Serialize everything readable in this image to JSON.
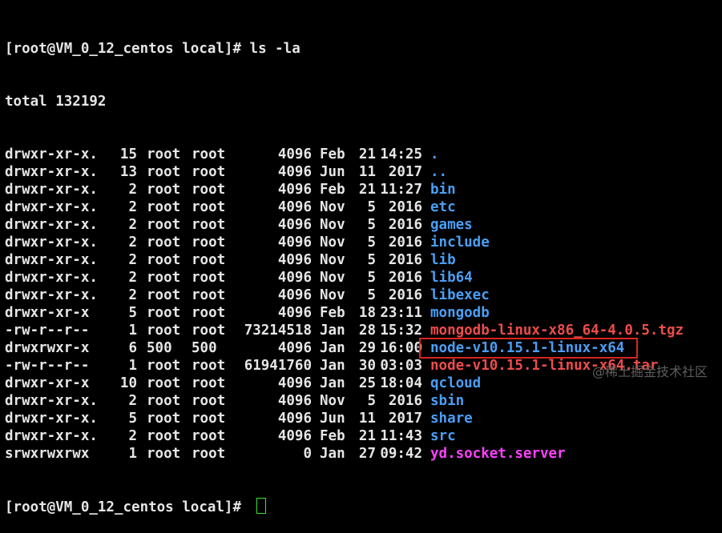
{
  "terminal": {
    "prompt_top": "[root@VM_0_12_centos local]# ls -la",
    "total": "total 132192",
    "prompt_bottom": "[root@VM_0_12_centos local]# "
  },
  "listing": [
    {
      "perm": "drwxr-xr-x.",
      "links": "15",
      "owner": "root",
      "group": "root",
      "size": "4096",
      "month": "Feb",
      "day": "21",
      "time": "14:25",
      "name": ".",
      "kind": "dir"
    },
    {
      "perm": "drwxr-xr-x.",
      "links": "13",
      "owner": "root",
      "group": "root",
      "size": "4096",
      "month": "Jun",
      "day": "11",
      "time": "2017",
      "name": "..",
      "kind": "dir"
    },
    {
      "perm": "drwxr-xr-x.",
      "links": "2",
      "owner": "root",
      "group": "root",
      "size": "4096",
      "month": "Feb",
      "day": "21",
      "time": "11:27",
      "name": "bin",
      "kind": "dir"
    },
    {
      "perm": "drwxr-xr-x.",
      "links": "2",
      "owner": "root",
      "group": "root",
      "size": "4096",
      "month": "Nov",
      "day": "5",
      "time": "2016",
      "name": "etc",
      "kind": "dir"
    },
    {
      "perm": "drwxr-xr-x.",
      "links": "2",
      "owner": "root",
      "group": "root",
      "size": "4096",
      "month": "Nov",
      "day": "5",
      "time": "2016",
      "name": "games",
      "kind": "dir"
    },
    {
      "perm": "drwxr-xr-x.",
      "links": "2",
      "owner": "root",
      "group": "root",
      "size": "4096",
      "month": "Nov",
      "day": "5",
      "time": "2016",
      "name": "include",
      "kind": "dir"
    },
    {
      "perm": "drwxr-xr-x.",
      "links": "2",
      "owner": "root",
      "group": "root",
      "size": "4096",
      "month": "Nov",
      "day": "5",
      "time": "2016",
      "name": "lib",
      "kind": "dir"
    },
    {
      "perm": "drwxr-xr-x.",
      "links": "2",
      "owner": "root",
      "group": "root",
      "size": "4096",
      "month": "Nov",
      "day": "5",
      "time": "2016",
      "name": "lib64",
      "kind": "dir"
    },
    {
      "perm": "drwxr-xr-x.",
      "links": "2",
      "owner": "root",
      "group": "root",
      "size": "4096",
      "month": "Nov",
      "day": "5",
      "time": "2016",
      "name": "libexec",
      "kind": "dir"
    },
    {
      "perm": "drwxr-xr-x",
      "links": "5",
      "owner": "root",
      "group": "root",
      "size": "4096",
      "month": "Feb",
      "day": "18",
      "time": "23:11",
      "name": "mongodb",
      "kind": "dir"
    },
    {
      "perm": "-rw-r--r--",
      "links": "1",
      "owner": "root",
      "group": "root",
      "size": "73214518",
      "month": "Jan",
      "day": "28",
      "time": "15:32",
      "name": "mongodb-linux-x86_64-4.0.5.tgz",
      "kind": "archive"
    },
    {
      "perm": "drwxrwxr-x",
      "links": "6",
      "owner": "500",
      "group": "500",
      "size": "4096",
      "month": "Jan",
      "day": "29",
      "time": "16:00",
      "name": "node-v10.15.1-linux-x64",
      "kind": "dir",
      "highlighted": true
    },
    {
      "perm": "-rw-r--r--",
      "links": "1",
      "owner": "root",
      "group": "root",
      "size": "61941760",
      "month": "Jan",
      "day": "30",
      "time": "03:03",
      "name": "node-v10.15.1-linux-x64.tar",
      "kind": "archive"
    },
    {
      "perm": "drwxr-xr-x",
      "links": "10",
      "owner": "root",
      "group": "root",
      "size": "4096",
      "month": "Jan",
      "day": "25",
      "time": "18:04",
      "name": "qcloud",
      "kind": "dir"
    },
    {
      "perm": "drwxr-xr-x.",
      "links": "2",
      "owner": "root",
      "group": "root",
      "size": "4096",
      "month": "Nov",
      "day": "5",
      "time": "2016",
      "name": "sbin",
      "kind": "dir"
    },
    {
      "perm": "drwxr-xr-x.",
      "links": "5",
      "owner": "root",
      "group": "root",
      "size": "4096",
      "month": "Jun",
      "day": "11",
      "time": "2017",
      "name": "share",
      "kind": "dir"
    },
    {
      "perm": "drwxr-xr-x.",
      "links": "2",
      "owner": "root",
      "group": "root",
      "size": "4096",
      "month": "Feb",
      "day": "21",
      "time": "11:43",
      "name": "src",
      "kind": "dir"
    },
    {
      "perm": "srwxrwxrwx",
      "links": "1",
      "owner": "root",
      "group": "root",
      "size": "0",
      "month": "Jan",
      "day": "27",
      "time": "09:42",
      "name": "yd.socket.server",
      "kind": "socket"
    }
  ],
  "colors": {
    "background": "#000000",
    "text": "#e6e6e6",
    "directory": "#4a9ff5",
    "archive": "#ee4c4c",
    "socket": "#ff40ff",
    "highlight_border": "#d8251d",
    "cursor": "#39e639"
  },
  "watermark": "@稀土掘金技术社区"
}
